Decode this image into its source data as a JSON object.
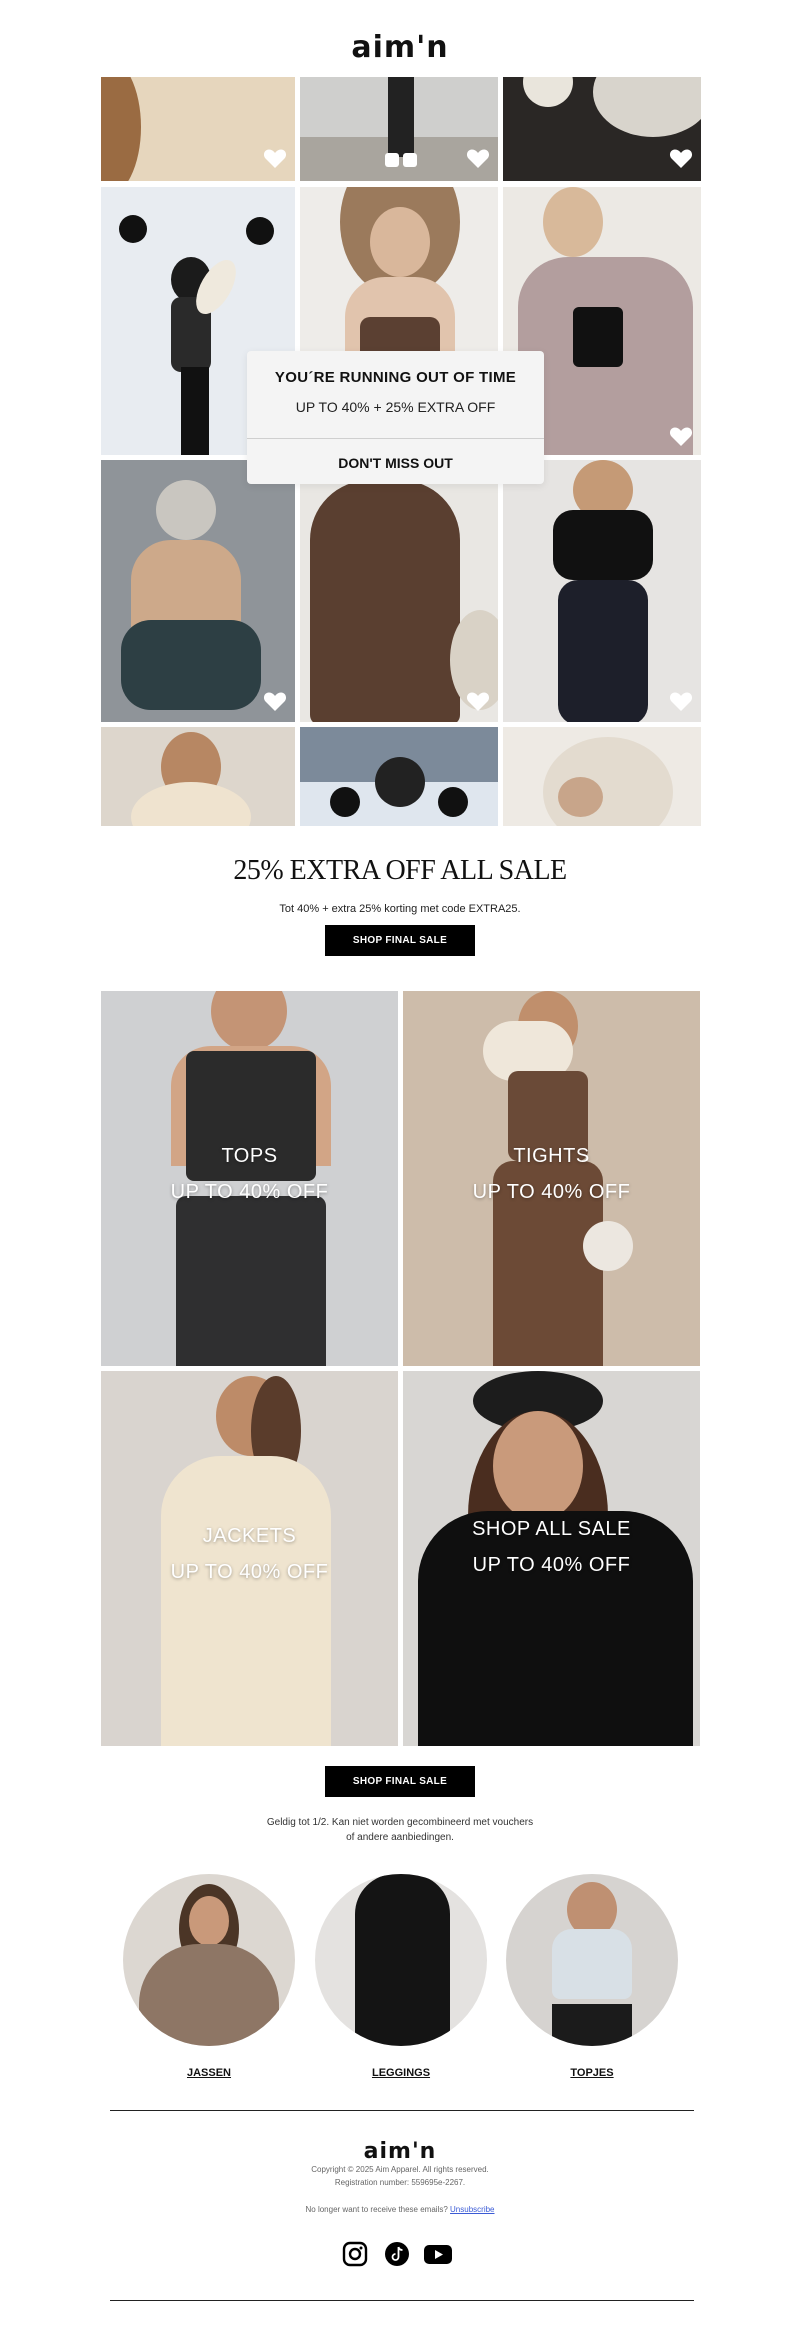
{
  "brand": {
    "logo_text": "aim'n",
    "logo_text_footer": "aim'n"
  },
  "popup": {
    "heading": "YOU´RE RUNNING OUT OF TIME",
    "subheading": "UP TO 40% + 25% EXTRA OFF",
    "cta": "DON'T MISS OUT"
  },
  "promo": {
    "headline": "25% EXTRA OFF ALL SALE",
    "subline": "Tot 40% + extra 25% korting met code EXTRA25.",
    "button": "SHOP FINAL SALE"
  },
  "categories": [
    {
      "title": "TOPS",
      "offer": "UP TO 40% OFF"
    },
    {
      "title": "TIGHTS",
      "offer": "UP TO 40% OFF"
    },
    {
      "title": "JACKETS",
      "offer": "UP TO 40% OFF"
    },
    {
      "title": "SHOP ALL SALE",
      "offer": "UP TO 40% OFF"
    }
  ],
  "second_button": "SHOP FINAL SALE",
  "fineprint": {
    "line1": "Geldig tot 1/2. Kan niet worden gecombineerd met vouchers",
    "line2": "of andere aanbiedingen."
  },
  "shop_links": [
    {
      "label": "JASSEN"
    },
    {
      "label": "LEGGINGS"
    },
    {
      "label": "TOPJES"
    }
  ],
  "footer": {
    "copyright": "Copyright © 2025 Aim Apparel. All rights reserved.",
    "registration": "Registration number: 559695e-2267.",
    "unsubscribe_prefix": "No longer want to receive these emails? ",
    "unsubscribe_link": "Unsubscribe"
  },
  "social_icons": [
    "instagram-icon",
    "tiktok-icon",
    "youtube-icon"
  ],
  "colors": {
    "button_bg": "#000000",
    "button_text": "#ffffff",
    "link": "#3b5bd6",
    "popup_bg": "#f4f4f4"
  }
}
